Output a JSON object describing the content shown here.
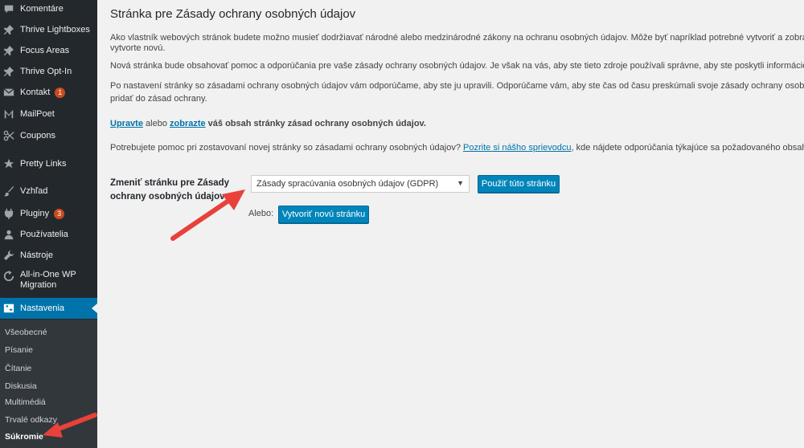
{
  "sidebar": {
    "items": [
      {
        "label": "Komentáre",
        "icon": "comment-icon"
      },
      {
        "label": "Thrive Lightboxes",
        "icon": "pin-icon"
      },
      {
        "label": "Focus Areas",
        "icon": "pin-icon"
      },
      {
        "label": "Thrive Opt-In",
        "icon": "pin-icon"
      },
      {
        "label": "Kontakt",
        "icon": "mail-icon",
        "badge": "1"
      },
      {
        "label": "MailPoet",
        "icon": "mailpoet-icon"
      },
      {
        "label": "Coupons",
        "icon": "scissors-icon"
      },
      {
        "label": "Pretty Links",
        "icon": "star-icon"
      },
      {
        "label": "Vzhľad",
        "icon": "brush-icon"
      },
      {
        "label": "Pluginy",
        "icon": "plugin-icon",
        "badge": "3"
      },
      {
        "label": "Používatelia",
        "icon": "users-icon"
      },
      {
        "label": "Nástroje",
        "icon": "wrench-icon"
      },
      {
        "label": "All-in-One WP Migration",
        "icon": "migration-icon"
      },
      {
        "label": "Nastavenia",
        "icon": "settings-icon"
      }
    ],
    "submenu": [
      "Všeobecné",
      "Písanie",
      "Čítanie",
      "Diskusia",
      "Multimédiá",
      "Trvalé odkazy",
      "Súkromie"
    ]
  },
  "main": {
    "title": "Stránka pre Zásady ochrany osobných údajov",
    "para1_line1": "Ako vlastník webových stránok budete možno musieť dodržiavať národné alebo medzinárodné zákony na ochranu osobných údajov. Môže byť napríklad potrebné vytvoriť a zobraziť zásady ochra",
    "para1_line2": "vytvorte novú.",
    "para2": "Nová stránka bude obsahovať pomoc a odporúčania pre vaše zásady ochrany osobných údajov. Je však na vás, aby ste tieto zdroje používali správne, aby ste poskytli informácie, ktoré vyžaduju va",
    "para3_line1": "Po nastavení stránky so zásadami ochrany osobných údajov vám odporúčame, aby ste ju upravili. Odporúčame vám, aby ste čas od času preskúmali svoje zásady ochrany osobných údajov, najmä",
    "para3_line2": "pridať do zásad ochrany.",
    "edit_link": "Upravte",
    "or_text": " alebo ",
    "view_link": "zobrazte",
    "edit_rest": " váš obsah stránky zásad ochrany osobných údajov.",
    "help_text": "Potrebujete pomoc pri zostavovaní novej stránky so zásadami ochrany osobných údajov? ",
    "guide_link": "Pozrite si nášho sprievodcu",
    "help_rest": ", kde nájdete odporúčania týkajúce sa požadovaného obsahu, spolu s odporú",
    "change_label": "Zmeniť stránku pre Zásady ochrany osobných údajov",
    "select_value": "Zásady spracúvania osobných údajov (GDPR)",
    "use_button": "Použiť túto stránku",
    "alebo": "Alebo:",
    "create_button": "Vytvoriť novú stránku"
  },
  "colors": {
    "sidebar_bg": "#23282d",
    "accent": "#0073aa",
    "arrow": "#e8413a",
    "badge": "#ca4a1f"
  }
}
